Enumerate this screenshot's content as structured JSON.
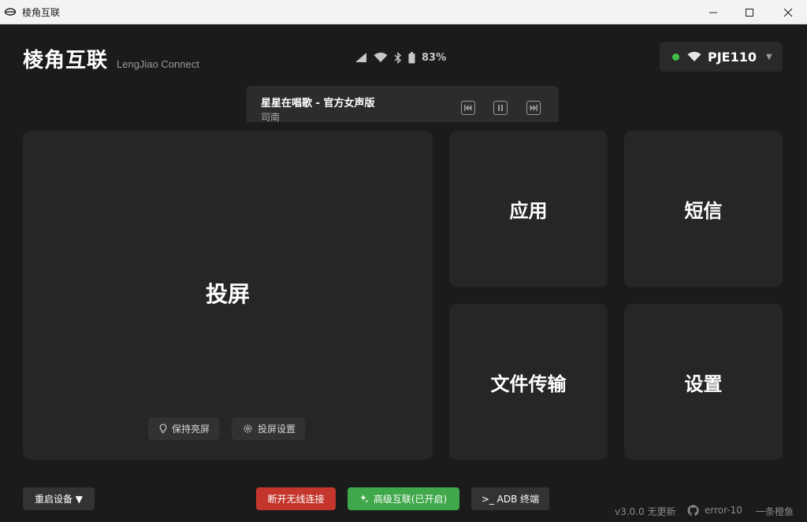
{
  "window": {
    "title": "棱角互联"
  },
  "header": {
    "brand": "棱角互联",
    "brand_sub": "LengJiao Connect",
    "battery": "83%",
    "device": {
      "name": "PJE110",
      "status_color": "#3fbf4a"
    }
  },
  "media": {
    "song": "星星在唱歌 - 官方女声版",
    "artist": "司南"
  },
  "tiles": {
    "screen": "投屏",
    "apps": "应用",
    "sms": "短信",
    "files": "文件传输",
    "settings": "设置"
  },
  "screen_chips": {
    "keep_awake": "保持亮屏",
    "cast_settings": "投屏设置"
  },
  "bottom": {
    "restart": "重启设备 ▼",
    "disconnect": "断开无线连接",
    "advanced": "高级互联(已开启)",
    "adb": ">_ ADB 终端"
  },
  "footer": {
    "version": "v3.0.0 无更新",
    "github": "error-10",
    "author": "一条橙鱼"
  },
  "colors": {
    "disconnect": "#c4352b",
    "advanced": "#3fa84a",
    "panel": "#262626",
    "background": "#1b1b1b"
  }
}
